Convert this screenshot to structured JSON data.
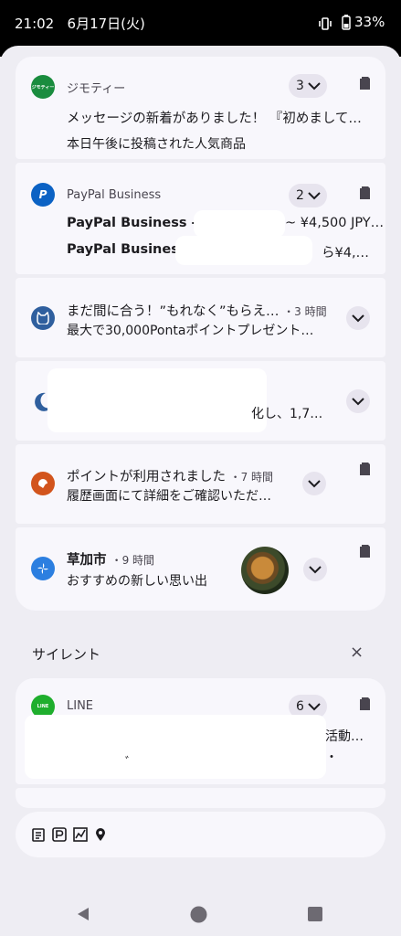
{
  "status_bar": {
    "time": "21:02",
    "date": "6月17日(火)",
    "battery": "33%"
  },
  "notifications": [
    {
      "app": "ジモティー",
      "icon_text": "ジモティー",
      "count": "3",
      "title": "メッセージの新着がありました！ 『初めまして…",
      "body": "本日午後に投稿された人気商品"
    },
    {
      "app": "PayPal Business",
      "icon_text": "P",
      "count": "2",
      "line1_title": "PayPal Business",
      "line1_text": "-",
      "line1_tail": "~ ¥4,500 JPY…",
      "line2_title": "PayPal Business",
      "line2_tail": "ら¥4,…"
    },
    {
      "title": "まだ間に合う！”もれなく”もらえ…",
      "time": "・3 時間",
      "body": "最大で30,000Pontaポイントプレゼント…"
    },
    {
      "body": "化し、1,7…"
    },
    {
      "title": "ポイントが利用されました",
      "time": "・7 時間",
      "body": "履歴画面にて詳細をご確認いただ…"
    },
    {
      "title": "草加市",
      "time": "・9 時間",
      "body": "おすすめの新しい思い出"
    }
  ],
  "silent_section": {
    "label": "サイレント",
    "close": "×"
  },
  "silent_notifications": [
    {
      "app": "LINE",
      "count": "6",
      "line1": "活動…",
      "line2": "ﾞ",
      "line3": "・"
    }
  ],
  "colors": {
    "jmty": "#1a8c3e",
    "paypal": "#0b62c4",
    "ponta": "#2f5f9e",
    "points": "#d2541c",
    "soka": "#2c7fe0",
    "line": "#1fae2d"
  }
}
